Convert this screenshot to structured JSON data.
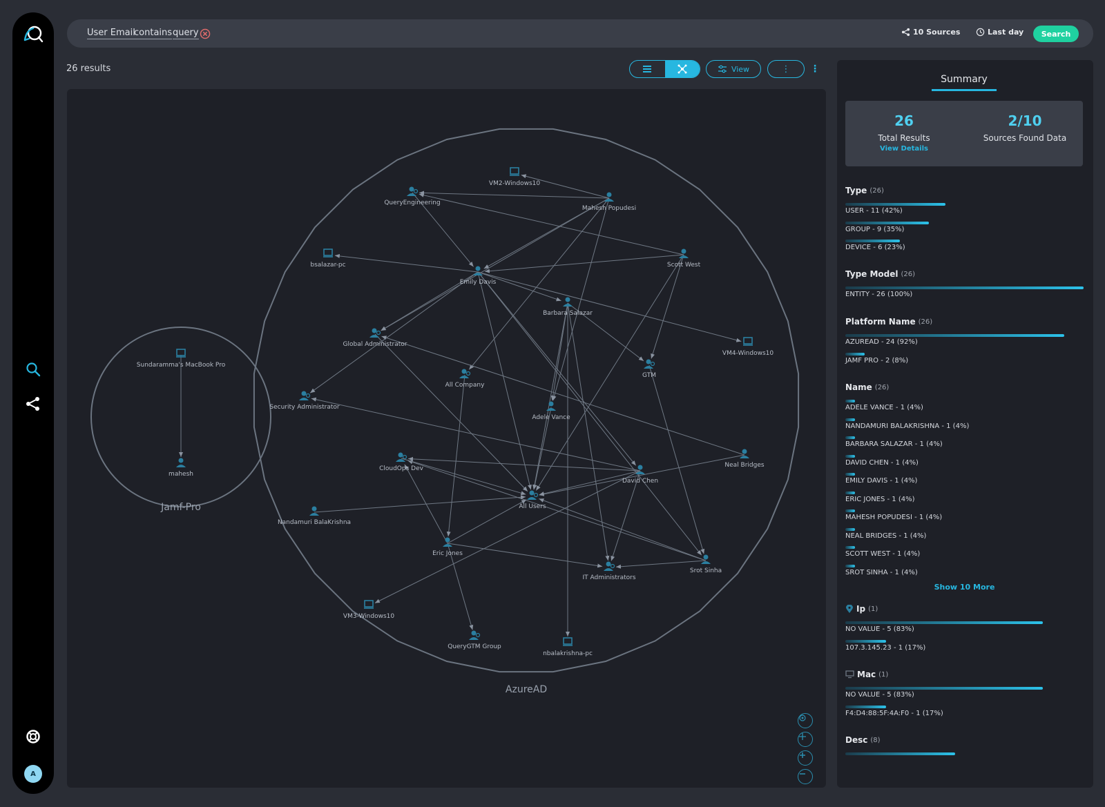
{
  "search": {
    "query_tokens": [
      "User Email",
      "contains",
      "query"
    ],
    "sources_label": "10 Sources",
    "time_label": "Last day",
    "button_label": "Search"
  },
  "results": {
    "count_label": "26 results"
  },
  "toolbar": {
    "view_label": "View",
    "more_label": "⋮",
    "kebab_label": "⋮"
  },
  "graph": {
    "clusters": [
      {
        "label": "Jamf-Pro"
      },
      {
        "label": "AzureAD"
      }
    ],
    "nodes": [
      {
        "id": "mac",
        "label": "Sundaramma's MacBook Pro",
        "type": "device"
      },
      {
        "id": "mahesh",
        "label": "mahesh",
        "type": "user"
      },
      {
        "id": "vm2",
        "label": "VM2-Windows10",
        "type": "device"
      },
      {
        "id": "qeng",
        "label": "QueryEngineering",
        "type": "group"
      },
      {
        "id": "mpop",
        "label": "Mahesh Popudesi",
        "type": "user"
      },
      {
        "id": "bsal",
        "label": "bsalazar-pc",
        "type": "device"
      },
      {
        "id": "scott",
        "label": "Scott West",
        "type": "user"
      },
      {
        "id": "emily",
        "label": "Emily Davis",
        "type": "user"
      },
      {
        "id": "barbara",
        "label": "Barbara Salazar",
        "type": "user"
      },
      {
        "id": "gadmin",
        "label": "Global Administrator",
        "type": "group"
      },
      {
        "id": "vm4",
        "label": "VM4-Windows10",
        "type": "device"
      },
      {
        "id": "gtm",
        "label": "GTM",
        "type": "group"
      },
      {
        "id": "allco",
        "label": "All Company",
        "type": "group"
      },
      {
        "id": "secadmin",
        "label": "Security Administrator",
        "type": "group"
      },
      {
        "id": "adele",
        "label": "Adele Vance",
        "type": "user"
      },
      {
        "id": "neal",
        "label": "Neal Bridges",
        "type": "user"
      },
      {
        "id": "cloudops",
        "label": "CloudOps Dev",
        "type": "group"
      },
      {
        "id": "david",
        "label": "David Chen",
        "type": "user"
      },
      {
        "id": "allusers",
        "label": "All Users",
        "type": "group"
      },
      {
        "id": "nanda",
        "label": "Nandamuri BalaKrishna",
        "type": "user"
      },
      {
        "id": "eric",
        "label": "Eric Jones",
        "type": "user"
      },
      {
        "id": "srot",
        "label": "Srot Sinha",
        "type": "user"
      },
      {
        "id": "itadmin",
        "label": "IT Administrators",
        "type": "group"
      },
      {
        "id": "vm3",
        "label": "VM3-Windows10",
        "type": "device"
      },
      {
        "id": "qgtm",
        "label": "QueryGTM Group",
        "type": "group"
      },
      {
        "id": "nbal",
        "label": "nbalakrishna-pc",
        "type": "device"
      }
    ],
    "edges": [
      [
        "mac",
        "mahesh"
      ],
      [
        "mpop",
        "vm2"
      ],
      [
        "mpop",
        "qeng"
      ],
      [
        "mpop",
        "emily"
      ],
      [
        "mpop",
        "allco"
      ],
      [
        "mpop",
        "adele"
      ],
      [
        "mpop",
        "gadmin"
      ],
      [
        "scott",
        "qeng"
      ],
      [
        "scott",
        "emily"
      ],
      [
        "scott",
        "gtm"
      ],
      [
        "scott",
        "allusers"
      ],
      [
        "qeng",
        "emily"
      ],
      [
        "emily",
        "bsal"
      ],
      [
        "emily",
        "gadmin"
      ],
      [
        "emily",
        "secadmin"
      ],
      [
        "emily",
        "vm4"
      ],
      [
        "emily",
        "allusers"
      ],
      [
        "emily",
        "david"
      ],
      [
        "emily",
        "srot"
      ],
      [
        "emily",
        "barbara"
      ],
      [
        "barbara",
        "gtm"
      ],
      [
        "barbara",
        "allusers"
      ],
      [
        "barbara",
        "itadmin"
      ],
      [
        "barbara",
        "nbal"
      ],
      [
        "barbara",
        "adele"
      ],
      [
        "gadmin",
        "allusers"
      ],
      [
        "neal",
        "gadmin"
      ],
      [
        "neal",
        "allusers"
      ],
      [
        "allco",
        "eric"
      ],
      [
        "gtm",
        "srot"
      ],
      [
        "david",
        "cloudops"
      ],
      [
        "david",
        "allusers"
      ],
      [
        "david",
        "itadmin"
      ],
      [
        "david",
        "secadmin"
      ],
      [
        "david",
        "vm3"
      ],
      [
        "srot",
        "allusers"
      ],
      [
        "srot",
        "itadmin"
      ],
      [
        "srot",
        "cloudops"
      ],
      [
        "cloudops",
        "allusers"
      ],
      [
        "nanda",
        "allusers"
      ],
      [
        "eric",
        "cloudops"
      ],
      [
        "eric",
        "allusers"
      ],
      [
        "eric",
        "itadmin"
      ],
      [
        "eric",
        "qgtm"
      ],
      [
        "adele",
        "allusers"
      ]
    ]
  },
  "summary": {
    "tab_label": "Summary",
    "total_results": "26",
    "total_results_label": "Total Results",
    "view_details_label": "View Details",
    "sources_found": "2/10",
    "sources_found_label": "Sources Found Data",
    "sections": [
      {
        "title": "Type",
        "count": "(26)",
        "icon": "",
        "rows": [
          {
            "label": "USER - 11 (42%)",
            "fraction": 0.42
          },
          {
            "label": "GROUP - 9 (35%)",
            "fraction": 0.35
          },
          {
            "label": "DEVICE - 6 (23%)",
            "fraction": 0.23
          }
        ]
      },
      {
        "title": "Type Model",
        "count": "(26)",
        "icon": "",
        "rows": [
          {
            "label": "ENTITY - 26 (100%)",
            "fraction": 1.0
          }
        ]
      },
      {
        "title": "Platform Name",
        "count": "(26)",
        "icon": "",
        "rows": [
          {
            "label": "AZUREAD - 24 (92%)",
            "fraction": 0.92
          },
          {
            "label": "JAMF PRO - 2 (8%)",
            "fraction": 0.08
          }
        ]
      },
      {
        "title": "Name",
        "count": "(26)",
        "icon": "",
        "rows": [
          {
            "label": "ADELE VANCE - 1 (4%)",
            "fraction": 0.04
          },
          {
            "label": "NANDAMURI BALAKRISHNA - 1 (4%)",
            "fraction": 0.04
          },
          {
            "label": "BARBARA SALAZAR - 1 (4%)",
            "fraction": 0.04
          },
          {
            "label": "DAVID CHEN - 1 (4%)",
            "fraction": 0.04
          },
          {
            "label": "EMILY DAVIS - 1 (4%)",
            "fraction": 0.04
          },
          {
            "label": "ERIC JONES - 1 (4%)",
            "fraction": 0.04
          },
          {
            "label": "MAHESH POPUDESI - 1 (4%)",
            "fraction": 0.04
          },
          {
            "label": "NEAL BRIDGES - 1 (4%)",
            "fraction": 0.04
          },
          {
            "label": "SCOTT WEST - 1 (4%)",
            "fraction": 0.04
          },
          {
            "label": "SROT SINHA - 1 (4%)",
            "fraction": 0.04
          }
        ],
        "show_more": "Show 10 More"
      },
      {
        "title": "Ip",
        "count": "(1)",
        "icon": "location-pin-icon",
        "rows": [
          {
            "label": "NO VALUE - 5 (83%)",
            "fraction": 0.83
          },
          {
            "label": "107.3.145.23 - 1 (17%)",
            "fraction": 0.17
          }
        ]
      },
      {
        "title": "Mac",
        "count": "(1)",
        "icon": "monitor-icon",
        "rows": [
          {
            "label": "NO VALUE - 5 (83%)",
            "fraction": 0.83
          },
          {
            "label": "F4:D4:88:5F:4A:F0 - 1 (17%)",
            "fraction": 0.17
          }
        ]
      },
      {
        "title": "Desc",
        "count": "(8)",
        "icon": "",
        "rows": [
          {
            "label": "",
            "fraction": 0.46
          }
        ]
      }
    ]
  },
  "colors": {
    "accent": "#27b7e0",
    "search_button": "#1fd1a0",
    "graph_node": "#2b7fa0",
    "graph_edge": "#6f7884",
    "cluster_ring": "#6b7480"
  }
}
